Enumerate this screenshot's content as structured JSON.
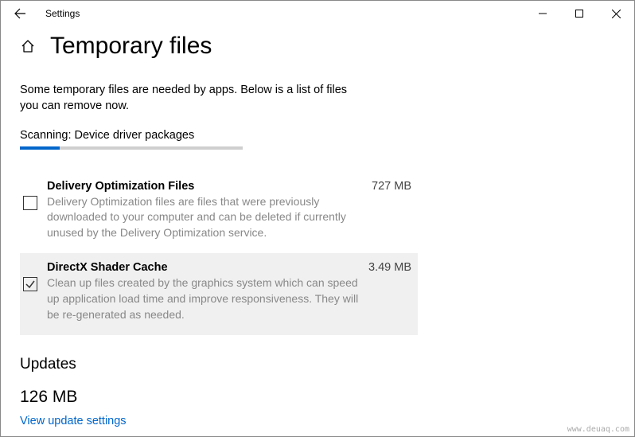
{
  "window": {
    "title": "Settings"
  },
  "page": {
    "title": "Temporary files",
    "intro": "Some temporary files are needed by apps. Below is a list of files you can remove now.",
    "scanning": "Scanning: Device driver packages",
    "progress_percent": 18
  },
  "items": [
    {
      "title": "Delivery Optimization Files",
      "size": "727 MB",
      "desc": "Delivery Optimization files are files that were previously downloaded to your computer and can be deleted if currently unused by the Delivery Optimization service.",
      "checked": false
    },
    {
      "title": "DirectX Shader Cache",
      "size": "3.49 MB",
      "desc": "Clean up files created by the graphics system which can speed up application load time and improve responsiveness. They will be re-generated as needed.",
      "checked": true
    }
  ],
  "updates": {
    "heading": "Updates",
    "size": "126 MB",
    "link": "View update settings"
  },
  "watermark": "www.deuaq.com"
}
